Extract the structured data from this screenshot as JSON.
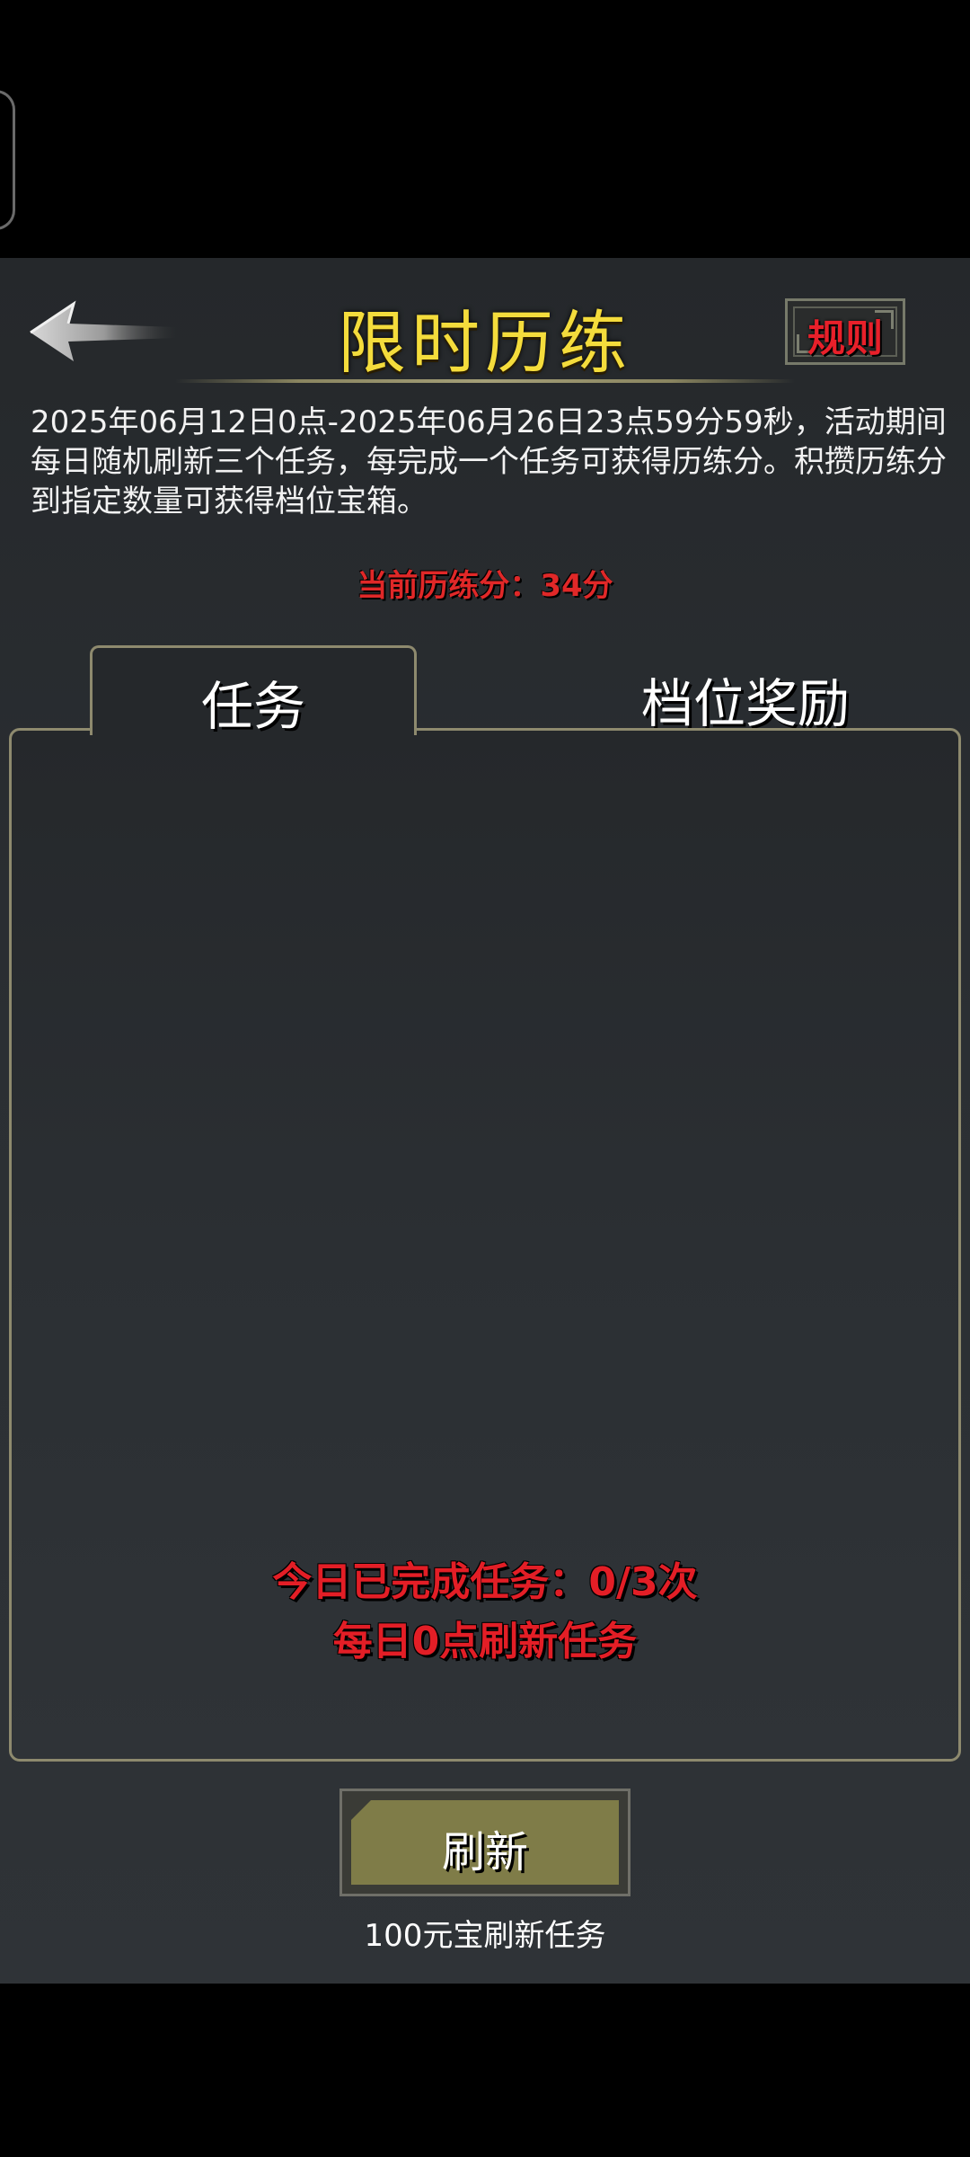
{
  "header": {
    "title": "限时历练",
    "rules_label": "规则"
  },
  "description": "2025年06月12日0点-2025年06月26日23点59分59秒，活动期间每日随机刷新三个任务，每完成一个任务可获得历练分。积攒历练分到指定数量可获得档位宝箱。",
  "score_text": "当前历练分：34分",
  "tabs": [
    {
      "label": "任务",
      "active": true
    },
    {
      "label": "档位奖励",
      "active": false
    }
  ],
  "task_status": {
    "completed": "今日已完成任务：0/3次",
    "refresh_hint": "每日0点刷新任务"
  },
  "refresh": {
    "button_label": "刷新",
    "cost_text": "100元宝刷新任务"
  },
  "colors": {
    "title": "#f4dc3c",
    "highlight_red": "#e02828",
    "panel_border": "#8e8a6e",
    "refresh_fill": "#7f7c48"
  },
  "icons": {
    "back": "left-arrow-icon"
  }
}
